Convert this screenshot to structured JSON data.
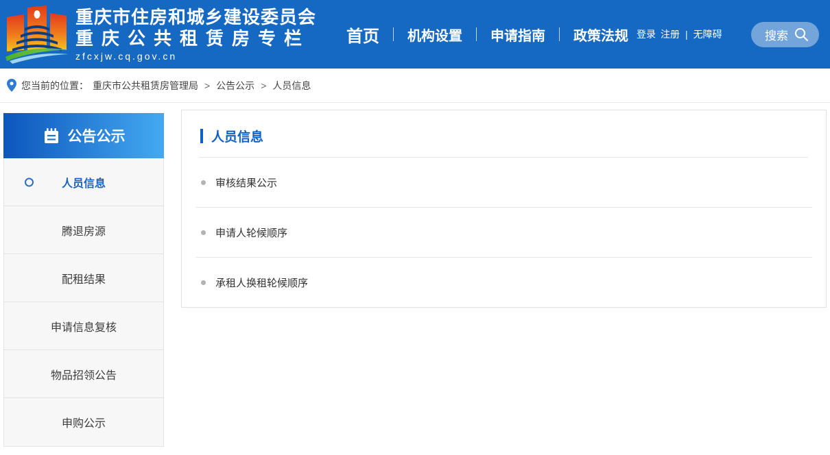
{
  "theme": {
    "header_blue": "#1669c2",
    "sidebar_gradient_start": "#0c56bd",
    "sidebar_gradient_end": "#44a9f1",
    "accent_blue": "#0e62c5",
    "active_item_blue": "#1a63c0"
  },
  "header": {
    "logo": {
      "title_line1": "重庆市住房和城乡建设委员会",
      "title_line2": "重庆公共租赁房专栏",
      "url": "zfcxjw.cq.gov.cn"
    },
    "nav": [
      {
        "label": "首页"
      },
      {
        "label": "机构设置"
      },
      {
        "label": "申请指南"
      },
      {
        "label": "政策法规"
      }
    ],
    "utility": {
      "login": "登录",
      "register": "注册",
      "separator": "|",
      "accessibility": "无障碍"
    },
    "search_label": "搜索"
  },
  "breadcrumb": {
    "prefix": "您当前的位置：",
    "separator": ">",
    "items": [
      "重庆市公共租赁房管理局",
      "公告公示",
      "人员信息"
    ]
  },
  "sidebar": {
    "header": {
      "label": "公告公示"
    },
    "items": [
      {
        "label": "人员信息"
      },
      {
        "label": "腾退房源"
      },
      {
        "label": "配租结果"
      },
      {
        "label": "申请信息复核"
      },
      {
        "label": "物品招领公告"
      },
      {
        "label": "申购公示"
      }
    ]
  },
  "main": {
    "title": "人员信息",
    "links": [
      "审核结果公示",
      "申请人轮候顺序",
      "承租人换租轮候顺序"
    ]
  }
}
